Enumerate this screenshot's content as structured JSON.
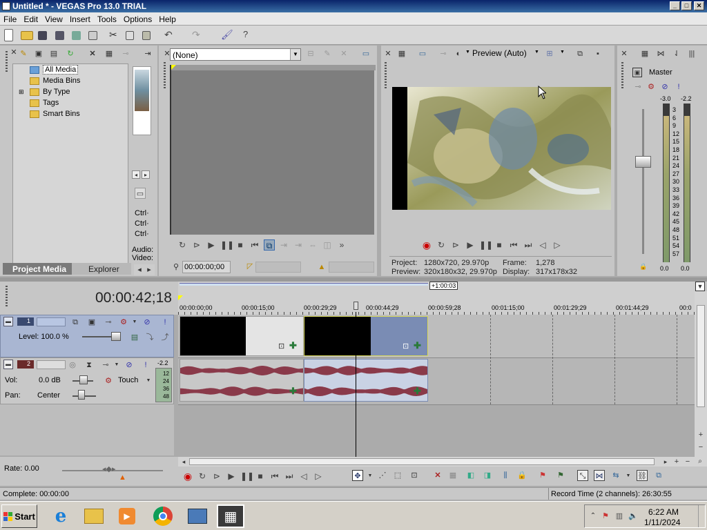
{
  "window": {
    "title": "Untitled * - VEGAS Pro 13.0 TRIAL",
    "buttons": [
      "_",
      "□",
      "✕"
    ]
  },
  "menu": [
    "File",
    "Edit",
    "View",
    "Insert",
    "Tools",
    "Options",
    "Help"
  ],
  "explorer": {
    "tree": [
      "All Media",
      "Media Bins",
      "By Type",
      "Tags",
      "Smart Bins"
    ],
    "tabs": [
      "Project Media",
      "Explorer"
    ],
    "side_labels": [
      "Ctrl·",
      "Ctrl·",
      "Ctrl·",
      "Audio:",
      "Video:"
    ]
  },
  "trimmer": {
    "preset": "(None)",
    "timecode": "00:00:00;00"
  },
  "preview": {
    "mode": "Preview (Auto)",
    "project_label": "Project:",
    "project_value": "1280x720, 29.970p",
    "preview_label": "Preview:",
    "preview_value": "320x180x32, 29.970p",
    "frame_label": "Frame:",
    "frame_value": "1,278",
    "display_label": "Display:",
    "display_value": "317x178x32"
  },
  "master": {
    "label": "Master",
    "db_left": "-3.0",
    "db_right": "-2.2",
    "scale": [
      "3",
      "6",
      "9",
      "12",
      "15",
      "18",
      "21",
      "24",
      "27",
      "30",
      "33",
      "36",
      "39",
      "42",
      "45",
      "48",
      "51",
      "54",
      "57"
    ],
    "foot_left": "0.0",
    "foot_right": "0.0"
  },
  "timeline": {
    "timecode": "00:00:42;18",
    "region_label": "+1:00:03",
    "ruler": [
      "00:00:00;00",
      "00:00:15;00",
      "00:00:29;29",
      "00:00:44;29",
      "00:00:59;28",
      "00:01:15;00",
      "00:01:29;29",
      "00:01:44;29",
      "00:0"
    ],
    "video_track": {
      "number": "1",
      "level": "Level: 100.0 %"
    },
    "audio_track": {
      "number": "2",
      "vol_label": "Vol:",
      "vol_value": "0.0 dB",
      "pan_label": "Pan:",
      "pan_value": "Center",
      "touch": "Touch",
      "db": "-2.2",
      "meter": [
        "12",
        "24",
        "36",
        "48"
      ]
    },
    "rate": "Rate: 0.00"
  },
  "status": {
    "left": "Complete: 00:00:00",
    "right": "Record Time (2 channels): 26:30:55"
  },
  "taskbar": {
    "start": "Start",
    "time": "6:22 AM",
    "date": "1/11/2024"
  }
}
